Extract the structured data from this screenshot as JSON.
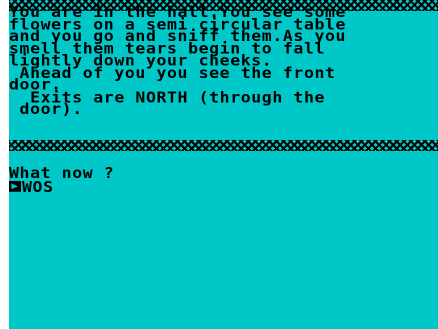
{
  "room": {
    "description": "You are in the hall.You see some\nflowers on a semi circular table\nand you go and sniff them.As you\nsmell them tears begin to fall\nlightly down your cheeks.\n Ahead of you you see the front\ndoor.\n  Exits are NORTH (through the\n door)."
  },
  "input": {
    "prompt": "What now ?",
    "cursor_glyph": "▶",
    "command": "WOS"
  },
  "colors": {
    "background": "#00c8c8",
    "text": "#000000",
    "border": "#000000"
  }
}
